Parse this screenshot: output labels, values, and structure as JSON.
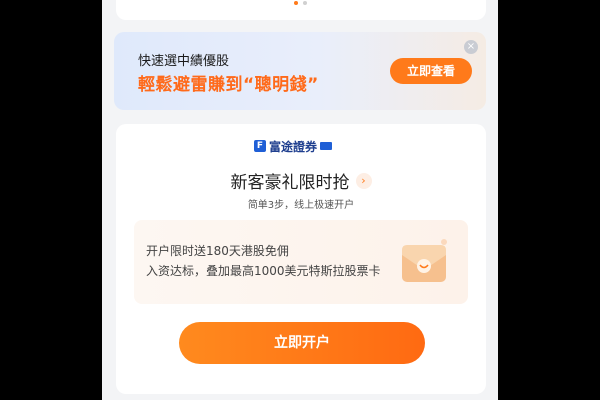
{
  "banner": {
    "line1": "快速選中績優股",
    "line2": "輕鬆避雷賺到“聰明錢”",
    "button": "立即查看",
    "close_glyph": "×"
  },
  "carousel": {
    "dot_count": 2,
    "active_index": 0
  },
  "card": {
    "logo_mark": "F",
    "logo_text": "富途證券",
    "headline": "新客豪礼限时抢",
    "chevron_glyph": "›",
    "subtitle": "简单3步，线上极速开户",
    "offer": {
      "line1": "开户限时送180天港股免佣",
      "line2": "入资达标，叠加最高1000美元特斯拉股票卡"
    },
    "cta": "立即开户"
  },
  "colors": {
    "accent": "#ff7a1a",
    "brand_blue": "#1f5fd6",
    "background": "#f3f4f6"
  }
}
